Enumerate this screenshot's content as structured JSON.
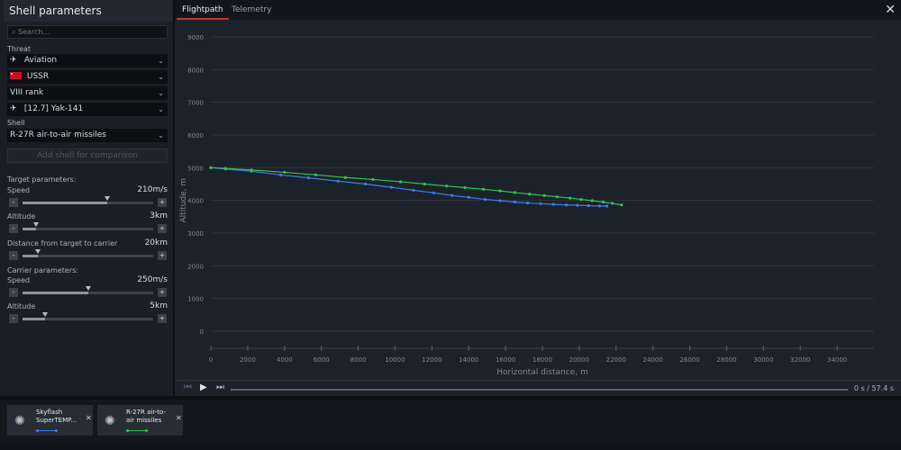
{
  "panel": {
    "title": "Shell parameters",
    "search_placeholder": "Search...",
    "threat_label": "Threat",
    "threat_type": "Aviation",
    "country": "USSR",
    "rank": "VIII rank",
    "vehicle": "[12.7] Yak-141",
    "shell_label": "Shell",
    "shell": "R-27R air-to-air missiles",
    "add_button": "Add shell for comparison",
    "target_params_label": "Target parameters:",
    "carrier_params_label": "Carrier parameters:",
    "sliders": [
      {
        "label": "Speed",
        "value": "210m/s",
        "level": 0.65
      },
      {
        "label": "Altitude",
        "value": "3km",
        "level": 0.1
      },
      {
        "label": "Distance from target to carrier",
        "value": "20km",
        "level": 0.12
      },
      {
        "label": "Speed",
        "value": "250m/s",
        "level": 0.5
      },
      {
        "label": "Altitude",
        "value": "5km",
        "level": 0.17
      }
    ],
    "minus": "-",
    "plus": "+"
  },
  "tabs": [
    "Flightpath",
    "Telemetry"
  ],
  "active_tab": "Flightpath",
  "playback": {
    "current": "0 s",
    "separator": "/",
    "total": "57.4 s"
  },
  "comparison": [
    {
      "name": "Skyflash SuperTEMP...",
      "color": "#3d7cf0"
    },
    {
      "name": "R-27R air-to-air missiles",
      "color": "#35c24f"
    }
  ],
  "chart_data": {
    "type": "line",
    "xlabel": "Horizontal distance, m",
    "ylabel": "Altitude, m",
    "xlim": [
      0,
      35000
    ],
    "ylim": [
      0,
      9000
    ],
    "xticks": [
      0,
      2000,
      4000,
      6000,
      8000,
      10000,
      12000,
      14000,
      16000,
      18000,
      20000,
      22000,
      24000,
      26000,
      28000,
      30000,
      32000,
      34000
    ],
    "yticks": [
      0,
      1000,
      2000,
      3000,
      4000,
      5000,
      6000,
      7000,
      8000,
      9000
    ],
    "grid": true,
    "series": [
      {
        "name": "Skyflash SuperTEMP...",
        "color": "#3d7cf0",
        "x": [
          0,
          800,
          2200,
          3800,
          5300,
          6900,
          8400,
          9800,
          11000,
          12100,
          13100,
          14000,
          14900,
          15700,
          16500,
          17200,
          17900,
          18600,
          19300,
          19900,
          20500,
          21100,
          21500
        ],
        "y": [
          5000,
          4960,
          4890,
          4780,
          4690,
          4590,
          4500,
          4400,
          4310,
          4230,
          4150,
          4090,
          4030,
          3990,
          3950,
          3920,
          3900,
          3880,
          3860,
          3850,
          3840,
          3830,
          3825
        ]
      },
      {
        "name": "R-27R air-to-air missiles",
        "color": "#35c24f",
        "x": [
          0,
          800,
          2200,
          4000,
          5700,
          7300,
          8800,
          10300,
          11600,
          12800,
          13800,
          14800,
          15700,
          16500,
          17300,
          18100,
          18800,
          19500,
          20100,
          20700,
          21300,
          21800,
          22300
        ],
        "y": [
          5000,
          4980,
          4930,
          4860,
          4780,
          4700,
          4640,
          4570,
          4500,
          4440,
          4390,
          4340,
          4290,
          4240,
          4190,
          4150,
          4110,
          4070,
          4030,
          3990,
          3950,
          3910,
          3860
        ]
      }
    ]
  }
}
